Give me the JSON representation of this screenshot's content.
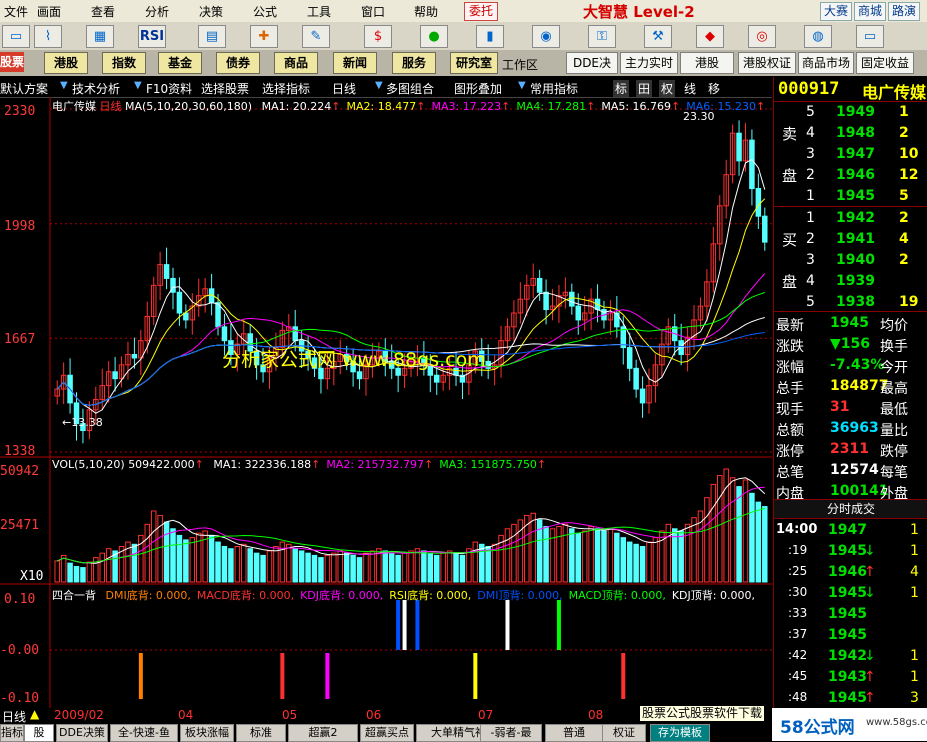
{
  "menubar": {
    "items": [
      "文件",
      "画面",
      "查看",
      "分析",
      "决策",
      "公式",
      "工具",
      "窗口",
      "帮助"
    ],
    "entrust": "委托",
    "brand": "大智慧 Level-2",
    "right_buttons": [
      "大赛",
      "商城",
      "路演"
    ]
  },
  "toolbar": {
    "icons": [
      "chart-icon",
      "kline-icon",
      "grid-icon",
      "rsi-icon",
      "grid2-icon",
      "pencil-icon",
      "cross-icon",
      "ruler-icon",
      "warning-icon",
      "dollar-icon",
      "traffic-icon",
      "barchart-icon",
      "binoculars-icon",
      "lock-icon",
      "hammer-icon",
      "diamond-icon",
      "circle-icon",
      "cd-icon",
      "hat-icon"
    ],
    "rsi": "RSI"
  },
  "navbar": {
    "left_red": "股票",
    "items": [
      "港股",
      "指数",
      "基金",
      "债券",
      "商品",
      "新闻",
      "服务",
      "研究室"
    ],
    "workspace": "工作区",
    "right": [
      "DDE决策",
      "主力实时组",
      "港股",
      "港股权证",
      "商品市场",
      "固定收益"
    ]
  },
  "funcbar": {
    "items": [
      "默认方案",
      "技术分析",
      "F10资料",
      "选择股票",
      "选择指标",
      "日线",
      "多图组合",
      "图形叠加",
      "常用指标"
    ],
    "right_buttons": [
      "标",
      "田",
      "权",
      "线",
      "移"
    ]
  },
  "chart": {
    "stock_name": "电广传媒",
    "period": "日线",
    "ma_label": "MA(5,10,20,30,60,180)",
    "ma": [
      {
        "name": "MA1:",
        "value": "20.224",
        "color": "#ffffff"
      },
      {
        "name": "MA2:",
        "value": "18.477",
        "color": "#ffff00"
      },
      {
        "name": "MA3:",
        "value": "17.223",
        "color": "#ff00ff"
      },
      {
        "name": "MA4:",
        "value": "17.281",
        "color": "#00ff00"
      },
      {
        "name": "MA5:",
        "value": "16.769",
        "color": "#ffffff"
      },
      {
        "name": "MA6:",
        "value": "15.230",
        "color": "#0060ff"
      }
    ],
    "price_ticks": [
      "2330",
      "1998",
      "1667",
      "1338"
    ],
    "high_label": "23.30",
    "low_label": "←13.38",
    "vol_label": "VOL(5,10,20)",
    "vol_value": "509422.000",
    "vol_ma": [
      {
        "name": "MA1:",
        "value": "322336.188",
        "color": "#ffffff"
      },
      {
        "name": "MA2:",
        "value": "215732.797",
        "color": "#ff00ff"
      },
      {
        "name": "MA3:",
        "value": "151875.750",
        "color": "#00ff00"
      }
    ],
    "vol_ticks": [
      "50942",
      "25471",
      "X10"
    ],
    "ind_title": "四合一背",
    "ind_items": [
      {
        "t": "DMI底背:",
        "v": "0.000",
        "c": "#ff8000"
      },
      {
        "t": "MACD底背:",
        "v": "0.000",
        "c": "#ff3030"
      },
      {
        "t": "KDJ底背:",
        "v": "0.000",
        "c": "#ff00ff"
      },
      {
        "t": "RSI底背:",
        "v": "0.000",
        "c": "#ffff00"
      },
      {
        "t": "DMI顶背:",
        "v": "0.000",
        "c": "#0050ff"
      },
      {
        "t": "MACD顶背:",
        "v": "0.000",
        "c": "#00ff00"
      },
      {
        "t": "KDJ顶背:",
        "v": "0.000",
        "c": "#ffffff"
      }
    ],
    "ind_ticks": [
      "0.10",
      "-0.00",
      "-0.10"
    ],
    "watermark": "分析家公式网 www.88gs.com"
  },
  "chart_data": {
    "type": "candlestick",
    "x_labels": [
      "2009/02",
      "04",
      "05",
      "06",
      "07",
      "08"
    ],
    "ylim": [
      13.38,
      23.3
    ],
    "close": [
      15.2,
      15.6,
      14.8,
      14.2,
      14.0,
      14.6,
      14.9,
      15.3,
      15.7,
      15.5,
      15.9,
      16.2,
      16.1,
      16.6,
      17.3,
      18.2,
      18.8,
      18.4,
      18.0,
      17.4,
      17.2,
      17.6,
      17.9,
      18.1,
      17.7,
      17.0,
      16.6,
      16.2,
      16.5,
      16.8,
      16.3,
      15.9,
      15.7,
      16.1,
      16.4,
      16.9,
      17.0,
      16.6,
      16.3,
      16.1,
      15.8,
      15.5,
      15.8,
      16.0,
      16.2,
      16.0,
      15.7,
      15.5,
      15.9,
      16.1,
      16.3,
      16.0,
      15.8,
      15.6,
      15.8,
      16.0,
      16.1,
      15.9,
      15.6,
      15.4,
      15.6,
      15.8,
      15.6,
      15.4,
      15.9,
      16.3,
      16.0,
      15.8,
      15.9,
      16.6,
      17.0,
      17.4,
      17.8,
      18.2,
      18.4,
      18.0,
      17.5,
      17.6,
      17.9,
      18.0,
      17.6,
      17.2,
      17.4,
      17.8,
      17.5,
      17.2,
      17.4,
      17.0,
      16.4,
      15.8,
      15.2,
      14.8,
      15.3,
      15.9,
      16.5,
      17.0,
      16.6,
      16.2,
      16.7,
      17.2,
      17.6,
      18.3,
      19.4,
      20.5,
      21.4,
      22.6,
      21.8,
      22.4,
      21.0,
      20.2,
      19.45
    ],
    "volume": [
      95000,
      120000,
      85000,
      70000,
      65000,
      90000,
      110000,
      130000,
      150000,
      140000,
      160000,
      180000,
      170000,
      210000,
      260000,
      320000,
      300000,
      270000,
      240000,
      210000,
      190000,
      200000,
      220000,
      230000,
      210000,
      180000,
      160000,
      150000,
      160000,
      170000,
      150000,
      130000,
      120000,
      140000,
      160000,
      180000,
      170000,
      150000,
      140000,
      130000,
      120000,
      110000,
      120000,
      130000,
      140000,
      130000,
      120000,
      110000,
      130000,
      140000,
      150000,
      140000,
      130000,
      120000,
      130000,
      140000,
      150000,
      140000,
      130000,
      120000,
      130000,
      140000,
      130000,
      120000,
      150000,
      180000,
      170000,
      160000,
      170000,
      210000,
      240000,
      260000,
      280000,
      300000,
      310000,
      280000,
      250000,
      240000,
      250000,
      260000,
      240000,
      220000,
      230000,
      250000,
      240000,
      230000,
      240000,
      220000,
      200000,
      180000,
      170000,
      160000,
      180000,
      200000,
      230000,
      260000,
      240000,
      230000,
      260000,
      290000,
      320000,
      380000,
      440000,
      480000,
      509422,
      470000,
      430000,
      460000,
      400000,
      360000,
      340000
    ]
  },
  "quote": {
    "code": "000917",
    "name": "电广传媒",
    "sell_label": [
      "卖",
      "盘"
    ],
    "buy_label": [
      "买",
      "盘"
    ],
    "sells": [
      {
        "n": "5",
        "p": "1949",
        "v": "1"
      },
      {
        "n": "4",
        "p": "1948",
        "v": "2"
      },
      {
        "n": "3",
        "p": "1947",
        "v": "10"
      },
      {
        "n": "2",
        "p": "1946",
        "v": "12"
      },
      {
        "n": "1",
        "p": "1945",
        "v": "5"
      }
    ],
    "buys": [
      {
        "n": "1",
        "p": "1942",
        "v": "2"
      },
      {
        "n": "2",
        "p": "1941",
        "v": "4"
      },
      {
        "n": "3",
        "p": "1940",
        "v": "2"
      },
      {
        "n": "4",
        "p": "1939",
        "v": ""
      },
      {
        "n": "5",
        "p": "1938",
        "v": "19"
      }
    ],
    "stats": [
      {
        "l": "最新",
        "v": "1945",
        "c": "green",
        "r": "均价"
      },
      {
        "l": "涨跌",
        "v": "▼156",
        "c": "green",
        "r": "换手"
      },
      {
        "l": "涨幅",
        "v": "-7.43%",
        "c": "green",
        "r": "今开"
      },
      {
        "l": "总手",
        "v": "184877",
        "c": "yellow",
        "r": "最高"
      },
      {
        "l": "现手",
        "v": "31",
        "c": "red",
        "r": "最低"
      },
      {
        "l": "总额",
        "v": "36963",
        "c": "cyan",
        "r": "量比"
      },
      {
        "l": "涨停",
        "v": "2311",
        "c": "red",
        "r": "跌停"
      },
      {
        "l": "总笔",
        "v": "12574",
        "c": "white",
        "r": "每笔"
      },
      {
        "l": "内盘",
        "v": "100141",
        "c": "green",
        "r": "外盘"
      }
    ],
    "ticks_title": "分时成交",
    "ticks": [
      {
        "t": "14:00",
        "p": "1947",
        "a": "",
        "c": "green",
        "v": "1"
      },
      {
        "t": ":19",
        "p": "1945",
        "a": "↓",
        "c": "green",
        "v": "1"
      },
      {
        "t": ":25",
        "p": "1946",
        "a": "↑",
        "c": "green",
        "v": "4"
      },
      {
        "t": ":30",
        "p": "1945",
        "a": "↓",
        "c": "green",
        "v": "1"
      },
      {
        "t": ":33",
        "p": "1945",
        "a": "",
        "c": "green",
        "v": ""
      },
      {
        "t": ":37",
        "p": "1945",
        "a": "",
        "c": "green",
        "v": ""
      },
      {
        "t": ":42",
        "p": "1942",
        "a": "↓",
        "c": "green",
        "v": "1"
      },
      {
        "t": ":45",
        "p": "1943",
        "a": "↑",
        "c": "green",
        "v": "1"
      },
      {
        "t": ":48",
        "p": "1945",
        "a": "↑",
        "c": "green",
        "v": "3"
      }
    ]
  },
  "bottom": {
    "left": [
      "日线",
      "指标",
      "股",
      "2009/02",
      "04",
      "05",
      "06",
      "07",
      "08"
    ],
    "tabs": [
      "DDE决策",
      "全-快速-鱼",
      "板块涨幅",
      "标准",
      "超赢2",
      "超赢买点",
      "大单精气神力",
      "-弱者-最",
      "普通",
      "权证",
      "存为模板"
    ],
    "banner": "股票公式股票软件下载",
    "logo": "58公式网",
    "logo_url": "www.58gs.com"
  }
}
